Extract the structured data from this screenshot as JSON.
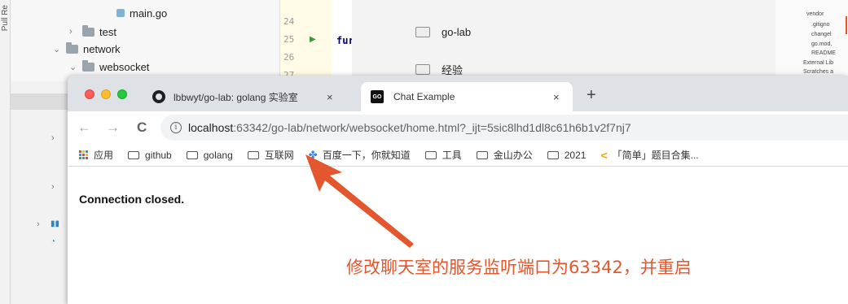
{
  "ide": {
    "side_tab": "Pull Re",
    "tree": [
      {
        "label": "main.go"
      },
      {
        "label": "test"
      },
      {
        "label": "network"
      },
      {
        "label": "websocket"
      }
    ],
    "line_numbers": [
      "24",
      "25",
      "26",
      "27"
    ],
    "code_keyword": "fur",
    "dir_items": [
      {
        "label": "go-lab"
      },
      {
        "label": "经验"
      }
    ],
    "right_panel": [
      "vendor",
      ".gitigno",
      "changel",
      "go.mod,",
      "README",
      "External Lib",
      "Scratches a"
    ]
  },
  "browser": {
    "tabs": [
      {
        "title": "lbbwyt/go-lab: golang 实验室",
        "close": "×"
      },
      {
        "title": "Chat Example",
        "close": "×",
        "icon_text": "GO"
      }
    ],
    "new_tab": "+",
    "nav": {
      "back": "←",
      "forward": "→",
      "reload": "C"
    },
    "url_host": "localhost",
    "url_rest": ":63342/go-lab/network/websocket/home.html?_ijt=5sic8lhd1dl8c61h6b1v2f7nj7",
    "bookmarks": [
      {
        "label": "应用"
      },
      {
        "label": "github"
      },
      {
        "label": "golang"
      },
      {
        "label": "互联网"
      },
      {
        "label": "百度一下，你就知道"
      },
      {
        "label": "工具"
      },
      {
        "label": "金山办公"
      },
      {
        "label": "2021"
      },
      {
        "label": "「简单」题目合集..."
      }
    ],
    "page_message": "Connection closed."
  },
  "annotation": {
    "text": "修改聊天室的服务监听端口为63342，并重启",
    "color": "#e4572e"
  },
  "colors": {
    "apps_icon": [
      "#ea4335",
      "#fbbc05",
      "#34a853",
      "#4285f4",
      "#ea4335",
      "#fbbc05",
      "#34a853",
      "#4285f4",
      "#ea4335"
    ]
  }
}
